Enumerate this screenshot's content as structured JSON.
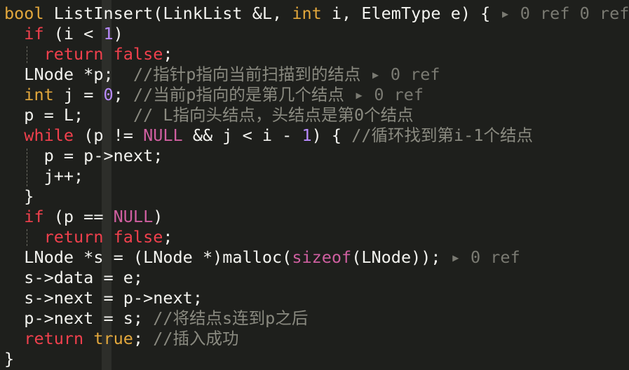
{
  "editor": {
    "lines": [
      {
        "tokens": [
          {
            "t": "bool",
            "c": "ty"
          },
          {
            "t": " ListInsert(LinkList &L, ",
            "c": "fn"
          },
          {
            "t": "int",
            "c": "ty"
          },
          {
            "t": " i, ElemType e) { ",
            "c": "fn"
          },
          {
            "t": "▸ 0 ref 0 ref",
            "c": "lens"
          }
        ]
      },
      {
        "tokens": [
          {
            "t": "  ",
            "c": "fn"
          },
          {
            "t": "if",
            "c": "kw"
          },
          {
            "t": " (i < ",
            "c": "fn"
          },
          {
            "t": "1",
            "c": "num"
          },
          {
            "t": ")",
            "c": "fn"
          }
        ]
      },
      {
        "tokens": [
          {
            "t": "    ",
            "c": "fn"
          },
          {
            "t": "return",
            "c": "kw"
          },
          {
            "t": " ",
            "c": "fn"
          },
          {
            "t": "false",
            "c": "kw"
          },
          {
            "t": ";",
            "c": "fn"
          }
        ]
      },
      {
        "tokens": [
          {
            "t": "  LNode *p;  ",
            "c": "fn"
          },
          {
            "t": "//指针p指向当前扫描到的结点 ",
            "c": "cm"
          },
          {
            "t": "▸ 0 ref",
            "c": "lens"
          }
        ]
      },
      {
        "tokens": [
          {
            "t": "  ",
            "c": "fn"
          },
          {
            "t": "int",
            "c": "ty"
          },
          {
            "t": " j = ",
            "c": "fn"
          },
          {
            "t": "0",
            "c": "num"
          },
          {
            "t": "; ",
            "c": "fn"
          },
          {
            "t": "//当前p指向的是第几个结点 ",
            "c": "cm"
          },
          {
            "t": "▸ 0 ref",
            "c": "lens"
          }
        ]
      },
      {
        "tokens": [
          {
            "t": "  p = L;     ",
            "c": "fn"
          },
          {
            "t": "// L指向头结点，头结点是第0个结点",
            "c": "cm"
          }
        ]
      },
      {
        "tokens": [
          {
            "t": "  ",
            "c": "fn"
          },
          {
            "t": "while",
            "c": "kw"
          },
          {
            "t": " (p != ",
            "c": "fn"
          },
          {
            "t": "NULL",
            "c": "nul"
          },
          {
            "t": " && j < i - ",
            "c": "fn"
          },
          {
            "t": "1",
            "c": "num"
          },
          {
            "t": ") { ",
            "c": "fn"
          },
          {
            "t": "//循环找到第i-1个结点",
            "c": "cm"
          }
        ]
      },
      {
        "tokens": [
          {
            "t": "    p = p->next;",
            "c": "fn"
          }
        ]
      },
      {
        "tokens": [
          {
            "t": "    j++;",
            "c": "fn"
          }
        ]
      },
      {
        "tokens": [
          {
            "t": "  }",
            "c": "fn"
          }
        ]
      },
      {
        "tokens": [
          {
            "t": "  ",
            "c": "fn"
          },
          {
            "t": "if",
            "c": "kw"
          },
          {
            "t": " (p == ",
            "c": "fn"
          },
          {
            "t": "NULL",
            "c": "nul"
          },
          {
            "t": ")",
            "c": "fn"
          }
        ]
      },
      {
        "tokens": [
          {
            "t": "    ",
            "c": "fn"
          },
          {
            "t": "return",
            "c": "kw"
          },
          {
            "t": " ",
            "c": "fn"
          },
          {
            "t": "false",
            "c": "kw"
          },
          {
            "t": ";",
            "c": "fn"
          }
        ]
      },
      {
        "tokens": [
          {
            "t": "  LNode *s = (LNode *)malloc(",
            "c": "fn"
          },
          {
            "t": "sizeof",
            "c": "nul"
          },
          {
            "t": "(LNode)); ",
            "c": "fn"
          },
          {
            "t": "▸ 0 ref",
            "c": "lens"
          }
        ]
      },
      {
        "tokens": [
          {
            "t": "  s->data = e;",
            "c": "fn"
          }
        ]
      },
      {
        "tokens": [
          {
            "t": "  s->next = p->next;",
            "c": "fn"
          }
        ]
      },
      {
        "tokens": [
          {
            "t": "  p->next = s; ",
            "c": "fn"
          },
          {
            "t": "//将结点s连到p之后",
            "c": "cm"
          }
        ]
      },
      {
        "tokens": [
          {
            "t": "  ",
            "c": "fn"
          },
          {
            "t": "return",
            "c": "kw"
          },
          {
            "t": " ",
            "c": "fn"
          },
          {
            "t": "true",
            "c": "ty"
          },
          {
            "t": "; ",
            "c": "fn"
          },
          {
            "t": "//插入成功",
            "c": "cm"
          }
        ]
      },
      {
        "tokens": [
          {
            "t": "}",
            "c": "fn"
          }
        ]
      }
    ]
  },
  "colors": {
    "background": "#1e1f1c",
    "keyword": "#f0404d",
    "type": "#e2a73c",
    "number": "#b98bff",
    "null": "#cf5fa0",
    "comment": "#8a8a80",
    "codelens": "#7a7a72"
  }
}
